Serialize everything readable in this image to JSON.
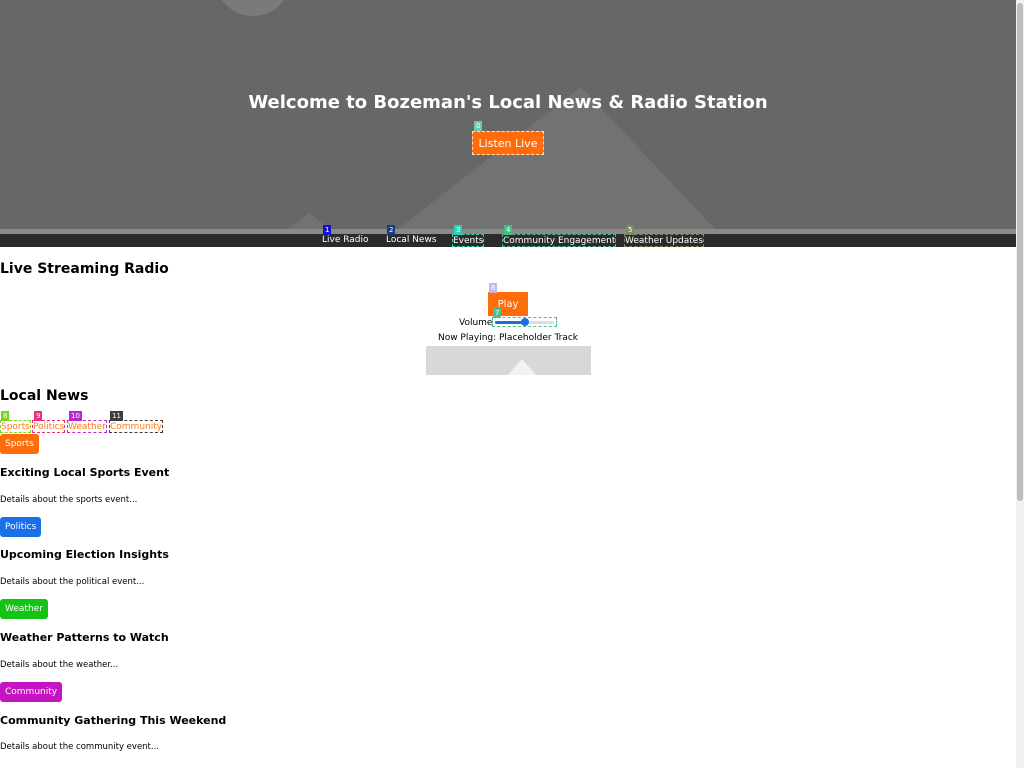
{
  "hero": {
    "title": "Welcome to Bozeman's Local News & Radio Station",
    "listen_button": {
      "label": "Listen Live",
      "tag": "0"
    }
  },
  "nav": {
    "items": [
      {
        "label": "Live Radio",
        "tag": "1"
      },
      {
        "label": "Local News",
        "tag": "2"
      },
      {
        "label": "Events",
        "tag": "3"
      },
      {
        "label": "Community Engagement",
        "tag": "4"
      },
      {
        "label": "Weather Updates",
        "tag": "5"
      }
    ]
  },
  "radio": {
    "heading": "Live Streaming Radio",
    "play_button": {
      "label": "Play",
      "tag": "6"
    },
    "volume": {
      "label": "Volume",
      "tag": "7",
      "level": 0.5
    },
    "now_playing": "Now Playing: Placeholder Track"
  },
  "news": {
    "heading": "Local News",
    "filters": [
      {
        "label": "Sports",
        "tag": "8"
      },
      {
        "label": "Politics",
        "tag": "9"
      },
      {
        "label": "Weather",
        "tag": "10"
      },
      {
        "label": "Community",
        "tag": "11"
      }
    ],
    "articles": [
      {
        "category": "Sports",
        "color": "#ff6c0c",
        "title": "Exciting Local Sports Event",
        "body": "Details about the sports event..."
      },
      {
        "category": "Politics",
        "color": "#1a6fe8",
        "title": "Upcoming Election Insights",
        "body": "Details about the political event..."
      },
      {
        "category": "Weather",
        "color": "#14c414",
        "title": "Weather Patterns to Watch",
        "body": "Details about the weather..."
      },
      {
        "category": "Community",
        "color": "#c414c4",
        "title": "Community Gathering This Weekend",
        "body": "Details about the community event..."
      }
    ]
  },
  "colors": {
    "accent": "#ff6c0c",
    "hero_bg": "#676767",
    "nav_bg": "#2b2b2b"
  }
}
